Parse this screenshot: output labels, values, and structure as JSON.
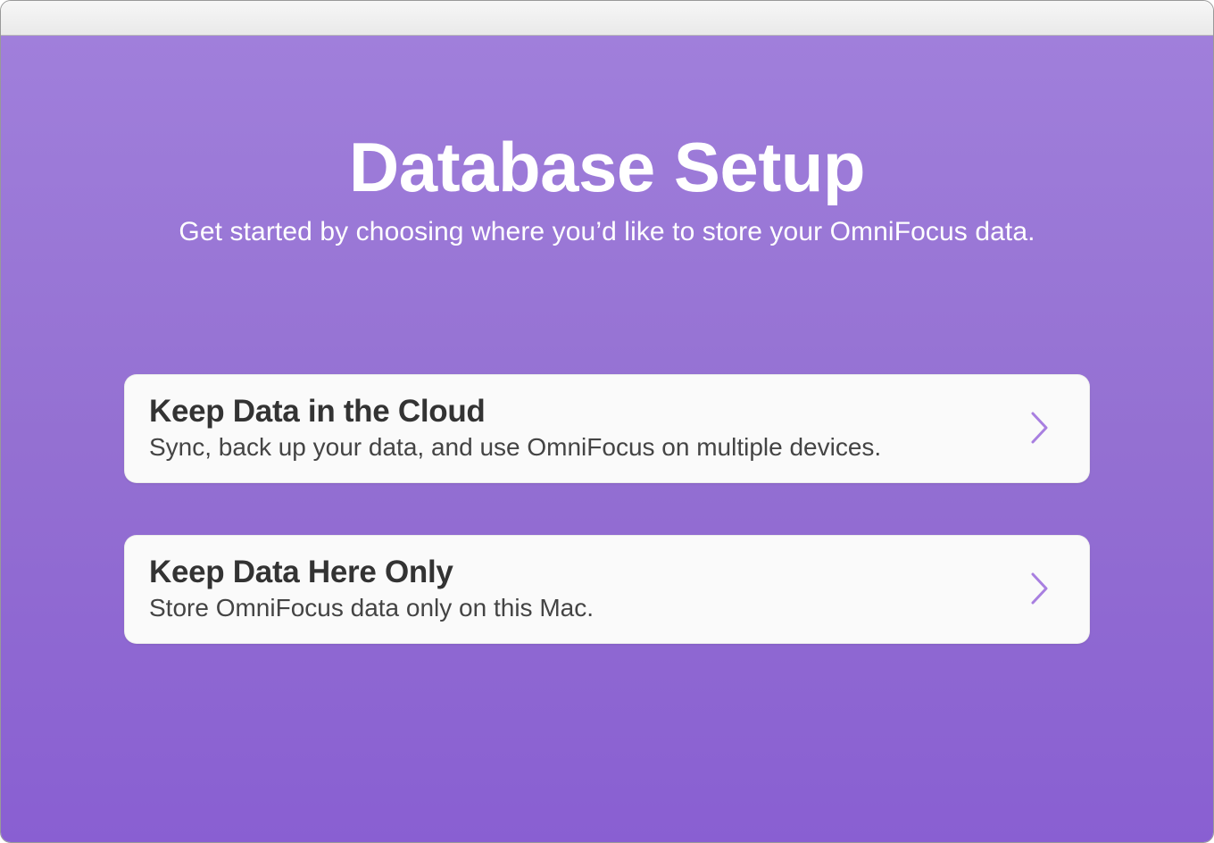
{
  "header": {
    "title": "Database Setup",
    "subtitle": "Get started by choosing where you’d like to store your OmniFocus data."
  },
  "options": [
    {
      "title": "Keep Data in the Cloud",
      "description": "Sync, back up your data, and use OmniFocus on multiple devices."
    },
    {
      "title": "Keep Data Here Only",
      "description": "Store OmniFocus data only on this Mac."
    }
  ],
  "colors": {
    "accent": "#9c7ed8",
    "chevron": "#a87fe0"
  }
}
